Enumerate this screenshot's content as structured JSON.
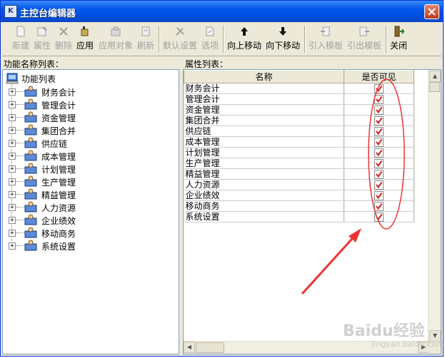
{
  "window": {
    "title": "主控台编辑器"
  },
  "toolbar": {
    "buttons": [
      {
        "label": "新建",
        "icon": "new-document-icon",
        "enabled": false
      },
      {
        "label": "属性",
        "icon": "properties-icon",
        "enabled": false
      },
      {
        "label": "删除",
        "icon": "delete-icon",
        "enabled": false
      },
      {
        "label": "应用",
        "icon": "apply-icon",
        "enabled": true
      },
      {
        "label": "应用对象",
        "icon": "apply-object-icon",
        "enabled": false
      },
      {
        "label": "刷新",
        "icon": "refresh-icon",
        "enabled": false
      },
      {
        "label": "默认设置",
        "icon": "default-settings-icon",
        "enabled": false
      },
      {
        "label": "选项",
        "icon": "options-icon",
        "enabled": false
      },
      {
        "label": "向上移动",
        "icon": "arrow-up-icon",
        "enabled": true
      },
      {
        "label": "向下移动",
        "icon": "arrow-down-icon",
        "enabled": true
      },
      {
        "label": "引入模板",
        "icon": "import-template-icon",
        "enabled": false
      },
      {
        "label": "引出模板",
        "icon": "export-template-icon",
        "enabled": false
      },
      {
        "label": "关闭",
        "icon": "exit-door-icon",
        "enabled": true
      }
    ]
  },
  "left_panel": {
    "label": "功能名称列表：",
    "root": "功能列表",
    "items": [
      "财务会计",
      "管理会计",
      "资金管理",
      "集团合并",
      "供应链",
      "成本管理",
      "计划管理",
      "生产管理",
      "精益管理",
      "人力资源",
      "企业绩效",
      "移动商务",
      "系统设置"
    ]
  },
  "right_panel": {
    "label": "属性列表：",
    "columns": [
      "名称",
      "是否可见"
    ],
    "rows": [
      {
        "name": "财务会计",
        "visible": true
      },
      {
        "name": "管理会计",
        "visible": true
      },
      {
        "name": "资金管理",
        "visible": true
      },
      {
        "name": "集团合并",
        "visible": true
      },
      {
        "name": "供应链",
        "visible": true
      },
      {
        "name": "成本管理",
        "visible": true
      },
      {
        "name": "计划管理",
        "visible": true
      },
      {
        "name": "生产管理",
        "visible": true
      },
      {
        "name": "精益管理",
        "visible": true
      },
      {
        "name": "人力资源",
        "visible": true
      },
      {
        "name": "企业绩效",
        "visible": true
      },
      {
        "name": "移动商务",
        "visible": true
      },
      {
        "name": "系统设置",
        "visible": true
      }
    ]
  },
  "colors": {
    "titlebar": "#0055ea",
    "annotation": "#ee3333",
    "check": "#d42020"
  },
  "watermark": {
    "brand": "Baidu经验",
    "sub": "jingyan.baidu.com"
  }
}
